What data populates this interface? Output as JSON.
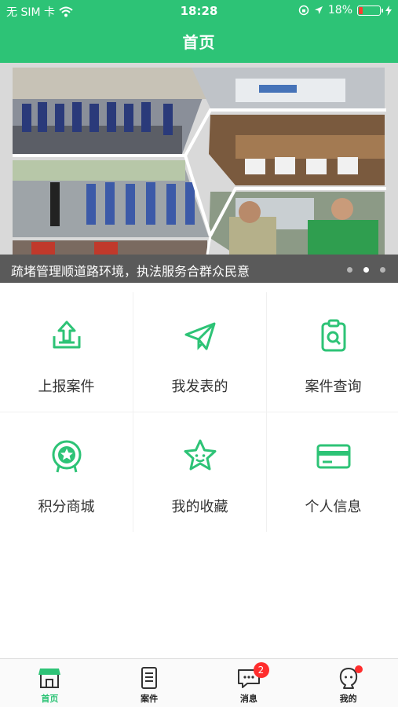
{
  "status_bar": {
    "carrier": "无 SIM 卡",
    "time": "18:28",
    "battery": "18%",
    "battery_level": 0.18
  },
  "header": {
    "title": "首页"
  },
  "banner": {
    "caption": "疏堵管理顺道路环境，执法服务合群众民意",
    "slide_count": 3,
    "active_slide": 2
  },
  "menu": {
    "items": [
      {
        "label": "上报案件",
        "icon": "upload-icon"
      },
      {
        "label": "我发表的",
        "icon": "paper-plane-icon"
      },
      {
        "label": "案件查询",
        "icon": "case-search-icon"
      },
      {
        "label": "积分商城",
        "icon": "medal-icon"
      },
      {
        "label": "我的收藏",
        "icon": "star-icon"
      },
      {
        "label": "个人信息",
        "icon": "card-icon"
      }
    ]
  },
  "tabbar": {
    "items": [
      {
        "label": "首页",
        "icon": "home-store-icon",
        "active": true
      },
      {
        "label": "案件",
        "icon": "document-icon"
      },
      {
        "label": "消息",
        "icon": "chat-icon",
        "badge": "2"
      },
      {
        "label": "我的",
        "icon": "profile-icon",
        "dot": true
      }
    ]
  },
  "colors": {
    "accent": "#2dc376",
    "badge": "#ff2d2d"
  }
}
